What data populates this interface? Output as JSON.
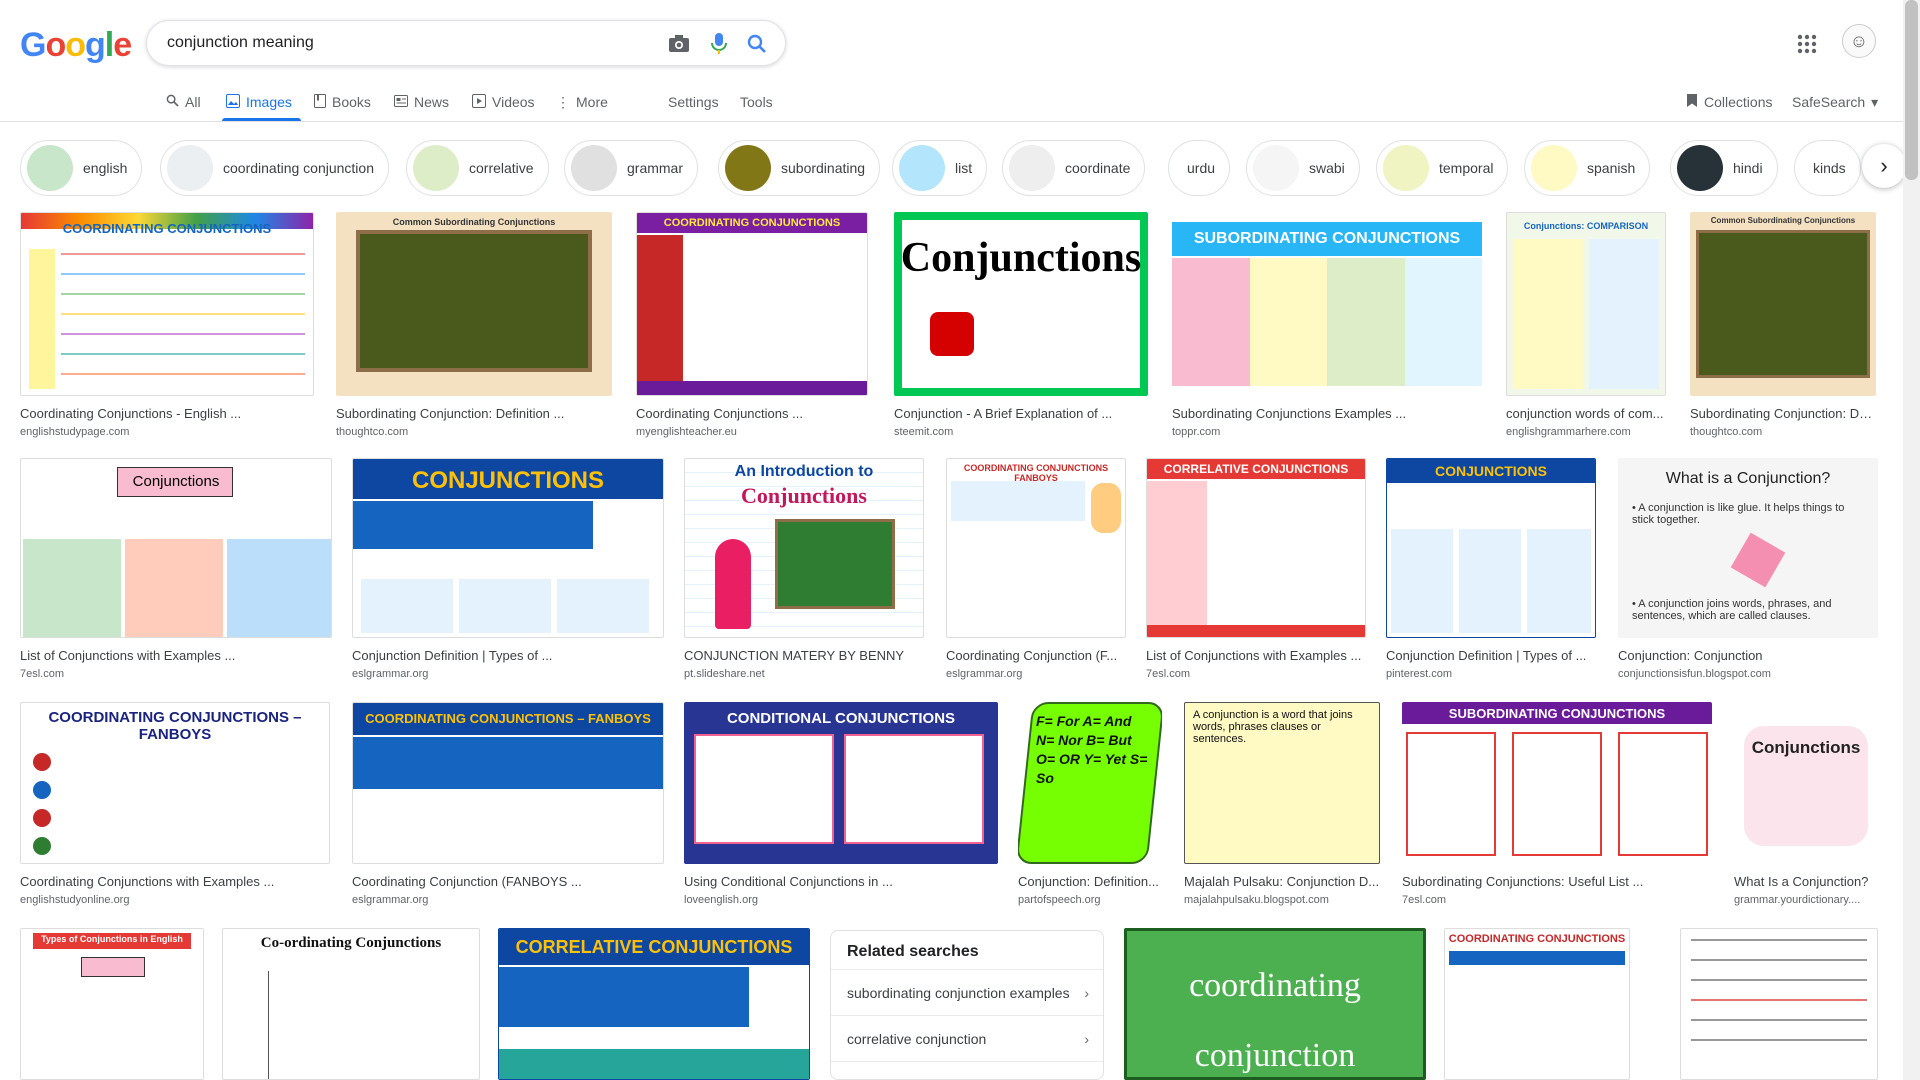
{
  "logo": {
    "letters": [
      "G",
      "o",
      "o",
      "g",
      "l",
      "e"
    ],
    "colors": [
      "#4285f4",
      "#ea4335",
      "#fbbc05",
      "#4285f4",
      "#34a853",
      "#ea4335"
    ]
  },
  "search": {
    "query": "conjunction meaning"
  },
  "tabs": [
    {
      "label": "All",
      "icon": "search-icon"
    },
    {
      "label": "Images",
      "icon": "image-icon",
      "active": true
    },
    {
      "label": "Books",
      "icon": "book-icon"
    },
    {
      "label": "News",
      "icon": "news-icon"
    },
    {
      "label": "Videos",
      "icon": "video-icon"
    },
    {
      "label": "More",
      "icon": "more-vert-icon"
    }
  ],
  "tools": {
    "settings": "Settings",
    "tools": "Tools",
    "collections": "Collections",
    "safesearch": "SafeSearch"
  },
  "chips": [
    "english",
    "coordinating conjunction",
    "correlative",
    "grammar",
    "subordinating",
    "list",
    "coordinate",
    "urdu",
    "swabi",
    "temporal",
    "spanish",
    "hindi",
    "kinds"
  ],
  "images": {
    "row1": [
      {
        "caption": "Coordinating Conjunctions - English ...",
        "source": "englishstudypage.com",
        "title": "COORDINATING CONJUNCTIONS"
      },
      {
        "caption": "Subordinating Conjunction: Definition ...",
        "source": "thoughtco.com",
        "title": "Common Subordinating Conjunctions"
      },
      {
        "caption": "Coordinating Conjunctions ...",
        "source": "myenglishteacher.eu",
        "title": "COORDINATING CONJUNCTIONS"
      },
      {
        "caption": "Conjunction - A Brief Explanation of ...",
        "source": "steemit.com",
        "title": "Conjunctions"
      },
      {
        "caption": "Subordinating Conjunctions Examples ...",
        "source": "toppr.com",
        "title": "SUBORDINATING CONJUNCTIONS"
      },
      {
        "caption": "conjunction words of com...",
        "source": "englishgrammarhere.com",
        "title": "Conjunctions: COMPARISON"
      },
      {
        "caption": "Subordinating Conjunction: De...",
        "source": "thoughtco.com",
        "title": "Common Subordinating Conjunctions"
      }
    ],
    "row2": [
      {
        "caption": "List of Conjunctions with Examples ...",
        "source": "7esl.com",
        "title": "Conjunctions"
      },
      {
        "caption": "Conjunction Definition | Types of ...",
        "source": "eslgrammar.org",
        "title": "CONJUNCTIONS"
      },
      {
        "caption": "CONJUNCTION MATERY BY BENNY",
        "source": "pt.slideshare.net",
        "title": "An Introduction to Conjunctions"
      },
      {
        "caption": "Coordinating Conjunction (F...",
        "source": "eslgrammar.org",
        "title": "COORDINATING CONJUNCTIONS FANBOYS"
      },
      {
        "caption": "List of Conjunctions with Examples ...",
        "source": "7esl.com",
        "title": "CORRELATIVE CONJUNCTIONS"
      },
      {
        "caption": "Conjunction Definition | Types of ...",
        "source": "pinterest.com",
        "title": "CONJUNCTIONS"
      },
      {
        "caption": "Conjunction: Conjunction",
        "source": "conjunctionsisfun.blogspot.com",
        "title": "What is a Conjunction?"
      }
    ],
    "row3": [
      {
        "caption": "Coordinating Conjunctions with Examples ...",
        "source": "englishstudyonline.org",
        "title": "COORDINATING CONJUNCTIONS – FANBOYS"
      },
      {
        "caption": "Coordinating Conjunction (FANBOYS ...",
        "source": "eslgrammar.org",
        "title": "COORDINATING CONJUNCTIONS – FANBOYS"
      },
      {
        "caption": "Using Conditional Conjunctions in ...",
        "source": "loveenglish.org",
        "title": "CONDITIONAL CONJUNCTIONS"
      },
      {
        "caption": "Conjunction: Definition...",
        "source": "partofspeech.org",
        "title": "F= For A= And N= Nor B= But O= OR Y= Yet S= So"
      },
      {
        "caption": "Majalah Pulsaku: Conjunction D...",
        "source": "majalahpulsaku.blogspot.com",
        "title": "A conjunction is a word that joins words, phrases clauses or sentences."
      },
      {
        "caption": "Subordinating Conjunctions: Useful List ...",
        "source": "7esl.com",
        "title": "SUBORDINATING CONJUNCTIONS"
      },
      {
        "caption": "What Is a Conjunction?",
        "source": "grammar.yourdictionary....",
        "title": "Conjunctions"
      }
    ],
    "row4": [
      {
        "title": "Types of Conjunctions in English"
      },
      {
        "title": "Co-ordinating Conjunctions"
      },
      {
        "title": "CORRELATIVE CONJUNCTIONS"
      },
      {
        "title": "coordinating conjunction"
      },
      {
        "title": "COORDINATING CONJUNCTIONS"
      },
      {
        "title": ""
      }
    ]
  },
  "related": {
    "heading": "Related searches",
    "items": [
      "subordinating conjunction examples",
      "correlative conjunction"
    ]
  }
}
